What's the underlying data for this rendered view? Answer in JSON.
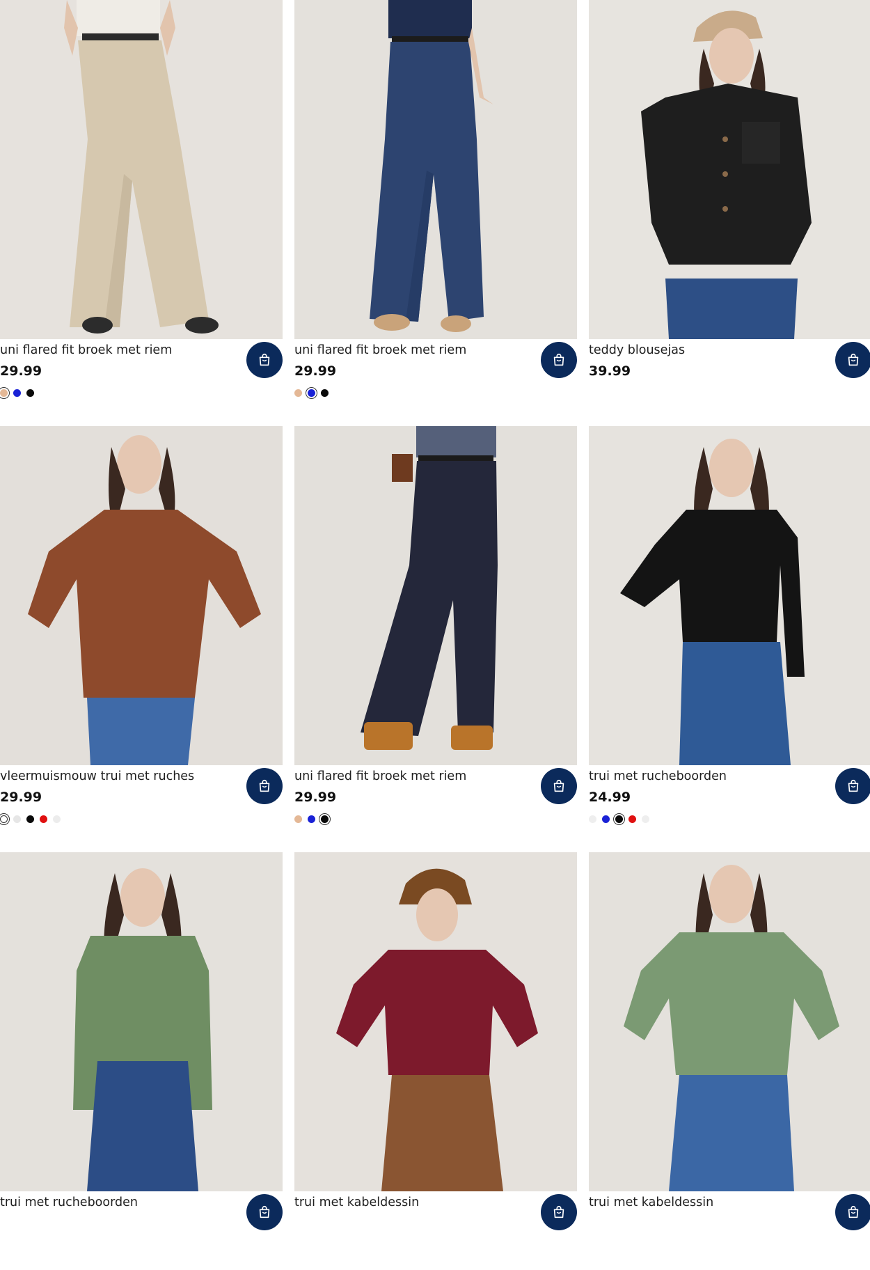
{
  "colors": {
    "cart_button_bg": "#0b2a5b",
    "cart_icon": "#ffffff"
  },
  "products": [
    {
      "name": "uni flared fit broek met riem",
      "price": "29.99",
      "image": "beige-flared-trousers",
      "swatches": [
        {
          "color": "#e4b896",
          "selected": true
        },
        {
          "color": "#1a22d6",
          "selected": false
        },
        {
          "color": "#0a0a0a",
          "selected": false
        }
      ]
    },
    {
      "name": "uni flared fit broek met riem",
      "price": "29.99",
      "image": "navy-flared-trousers",
      "swatches": [
        {
          "color": "#e4b896",
          "selected": false
        },
        {
          "color": "#1a22d6",
          "selected": true
        },
        {
          "color": "#0a0a0a",
          "selected": false
        }
      ]
    },
    {
      "name": "teddy blousejas",
      "price": "39.99",
      "image": "black-teddy-shirt-jacket",
      "swatches": []
    },
    {
      "name": "vleermuismouw trui met ruches",
      "price": "29.99",
      "image": "rust-batwing-sweater",
      "swatches": [
        {
          "color": "#ffffff",
          "selected": true
        },
        {
          "color": "#e6e6e6",
          "selected": false
        },
        {
          "color": "#0a0a0a",
          "selected": false
        },
        {
          "color": "#e01010",
          "selected": false
        },
        {
          "color": "#ececec",
          "selected": false
        }
      ]
    },
    {
      "name": "uni flared fit broek met riem",
      "price": "29.99",
      "image": "black-flared-trousers",
      "swatches": [
        {
          "color": "#e4b896",
          "selected": false
        },
        {
          "color": "#1a22d6",
          "selected": false
        },
        {
          "color": "#0a0a0a",
          "selected": true
        }
      ]
    },
    {
      "name": "trui met rucheboorden",
      "price": "24.99",
      "image": "black-ruffle-sweater",
      "swatches": [
        {
          "color": "#eeeeee",
          "selected": false
        },
        {
          "color": "#1a22d6",
          "selected": false
        },
        {
          "color": "#0a0a0a",
          "selected": true
        },
        {
          "color": "#e01010",
          "selected": false
        },
        {
          "color": "#eeeeee",
          "selected": false
        }
      ]
    },
    {
      "name": "trui met rucheboorden",
      "price": "",
      "image": "green-ruffle-sweater",
      "swatches": []
    },
    {
      "name": "trui met kabeldessin",
      "price": "",
      "image": "burgundy-cable-sweater",
      "swatches": []
    },
    {
      "name": "trui met kabeldessin",
      "price": "",
      "image": "green-cable-sweater",
      "swatches": []
    }
  ]
}
